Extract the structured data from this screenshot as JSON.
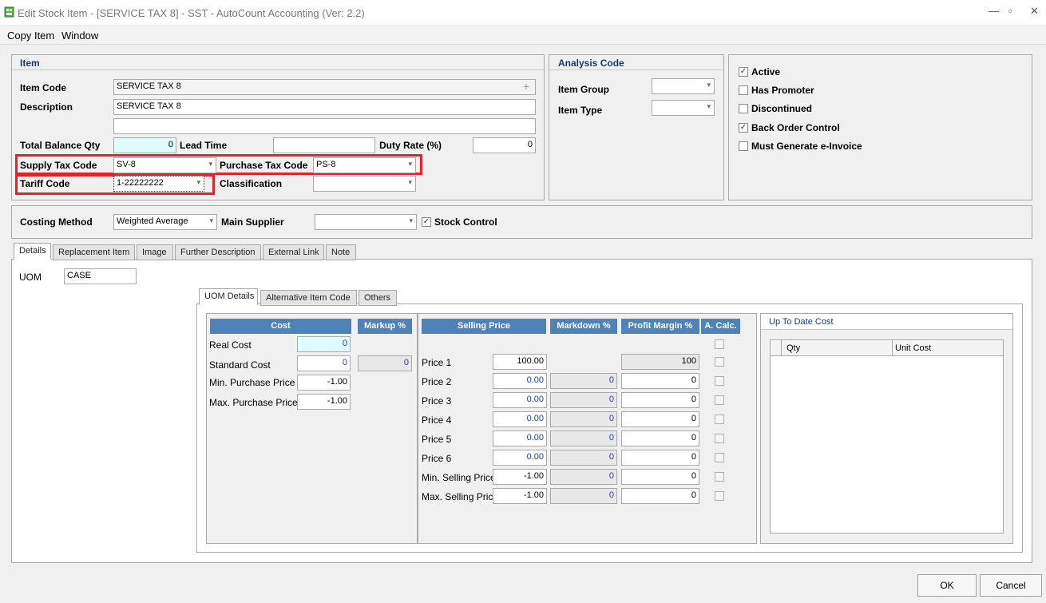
{
  "window": {
    "title": "Edit Stock Item - [SERVICE TAX 8] - SST - AutoCount Accounting (Ver: 2.2)"
  },
  "menu": [
    "Copy Item",
    "Window"
  ],
  "item": {
    "title": "Item",
    "item_code_label": "Item Code",
    "item_code": "SERVICE TAX 8",
    "description_label": "Description",
    "description": "SERVICE TAX 8",
    "description2": "",
    "total_balance_qty_label": "Total Balance Qty",
    "total_balance_qty": "0",
    "lead_time_label": "Lead Time",
    "lead_time": "",
    "duty_rate_label": "Duty Rate (%)",
    "duty_rate": "0",
    "supply_tax_code_label": "Supply Tax Code",
    "supply_tax_code": "SV-8",
    "purchase_tax_code_label": "Purchase Tax Code",
    "purchase_tax_code": "PS-8",
    "tariff_code_label": "Tariff Code",
    "tariff_code": "1-22222222",
    "classification_label": "Classification",
    "classification": ""
  },
  "analysis": {
    "title": "Analysis Code",
    "item_group_label": "Item Group",
    "item_group": "",
    "item_type_label": "Item Type",
    "item_type": ""
  },
  "flags": [
    {
      "label": "Active",
      "checked": true
    },
    {
      "label": "Has Promoter",
      "checked": false
    },
    {
      "label": "Discontinued",
      "checked": false
    },
    {
      "label": "Back Order Control",
      "checked": true
    },
    {
      "label": "Must Generate e-Invoice",
      "checked": false
    }
  ],
  "costing": {
    "costing_method_label": "Costing Method",
    "costing_method": "Weighted Average",
    "main_supplier_label": "Main Supplier",
    "main_supplier": "",
    "stock_control_label": "Stock Control",
    "stock_control": true
  },
  "tabs": [
    "Details",
    "Replacement Item",
    "Image",
    "Further Description",
    "External Link",
    "Note"
  ],
  "uom": {
    "label": "UOM",
    "value": "CASE"
  },
  "subtabs": [
    "UOM Details",
    "Alternative Item Code",
    "Others"
  ],
  "cost": {
    "header": "Cost",
    "markup_header": "Markup %",
    "rows": [
      {
        "label": "Real Cost",
        "value": "0"
      },
      {
        "label": "Standard Cost",
        "value": "0",
        "markup": "0"
      },
      {
        "label": "Min. Purchase Price",
        "value": "-1.00"
      },
      {
        "label": "Max. Purchase Price",
        "value": "-1.00"
      }
    ]
  },
  "selling": {
    "headers": {
      "price": "Selling Price",
      "markdown": "Markdown %",
      "margin": "Profit Margin %",
      "acalc": "A. Calc."
    },
    "rows": [
      {
        "label": "Price 1",
        "price": "100.00",
        "markdown": "",
        "margin": "100"
      },
      {
        "label": "Price 2",
        "price": "0.00",
        "markdown": "0",
        "margin": "0"
      },
      {
        "label": "Price 3",
        "price": "0.00",
        "markdown": "0",
        "margin": "0"
      },
      {
        "label": "Price 4",
        "price": "0.00",
        "markdown": "0",
        "margin": "0"
      },
      {
        "label": "Price 5",
        "price": "0.00",
        "markdown": "0",
        "margin": "0"
      },
      {
        "label": "Price 6",
        "price": "0.00",
        "markdown": "0",
        "margin": "0"
      },
      {
        "label": "Min. Selling Price",
        "price": "-1.00",
        "markdown": "0",
        "margin": "0"
      },
      {
        "label": "Max. Selling Price",
        "price": "-1.00",
        "markdown": "0",
        "margin": "0"
      }
    ]
  },
  "up_to_date_cost": {
    "title": "Up To Date Cost",
    "columns": [
      "Qty",
      "Unit Cost"
    ]
  },
  "buttons": {
    "ok": "OK",
    "cancel": "Cancel"
  },
  "colors": {
    "header_blue": "#4e82b8",
    "highlight_red": "#e8202a",
    "title_navy": "#1a3a6b"
  }
}
